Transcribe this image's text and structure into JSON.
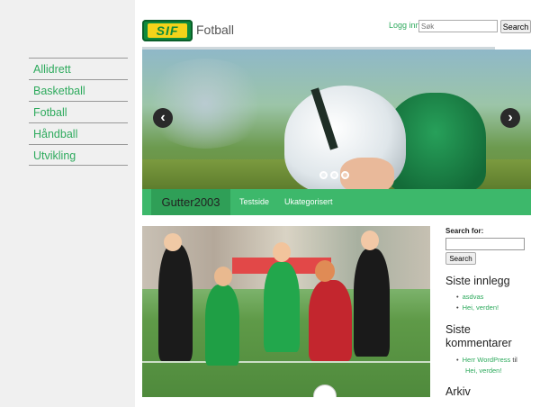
{
  "site": {
    "logo_text": "SIF",
    "title": "Fotball"
  },
  "header": {
    "login_label": "Logg inn",
    "search_placeholder": "Søk",
    "search_button": "Search"
  },
  "sidebar": {
    "items": [
      {
        "label": "Allidrett"
      },
      {
        "label": "Basketball"
      },
      {
        "label": "Fotball"
      },
      {
        "label": "Håndball"
      },
      {
        "label": "Utvikling"
      }
    ]
  },
  "slider": {
    "prev_symbol": "‹",
    "next_symbol": "›",
    "slide_count": 3
  },
  "nav": {
    "current": "Gutter2003",
    "links": [
      {
        "label": "Testside"
      },
      {
        "label": "Ukategorisert"
      }
    ]
  },
  "widgets": {
    "search_label": "Search for:",
    "search_button": "Search",
    "recent_posts_title": "Siste innlegg",
    "recent_posts": [
      {
        "label": "asdvas"
      },
      {
        "label": "Hei, verden!"
      }
    ],
    "recent_comments_title_line1": "Siste",
    "recent_comments_title_line2": "kommentarer",
    "recent_comment": {
      "author": "Herr WordPress",
      "connector": "til",
      "post": "Hei, verden!"
    },
    "archive_title": "Arkiv"
  },
  "colors": {
    "accent_green": "#3db86b",
    "link_green": "#2eaa5d",
    "page_bg": "#f0f0f0"
  }
}
